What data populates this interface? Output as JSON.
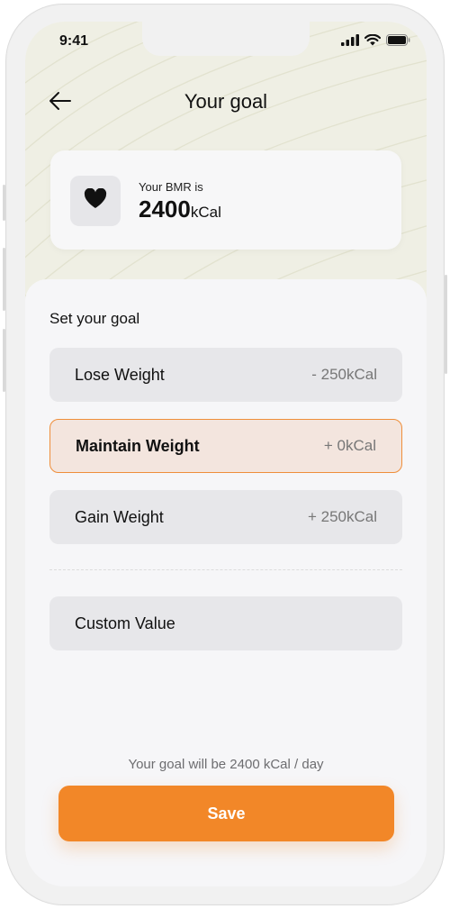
{
  "status_bar": {
    "time": "9:41"
  },
  "header": {
    "title": "Your goal",
    "back_icon": "arrow-left-icon"
  },
  "bmr": {
    "label": "Your BMR is",
    "value": "2400",
    "unit": "kCal",
    "icon": "heart-icon"
  },
  "goal_section": {
    "title": "Set your goal",
    "options": [
      {
        "label": "Lose Weight",
        "delta": "- 250kCal",
        "selected": false
      },
      {
        "label": "Maintain Weight",
        "delta": "+ 0kCal",
        "selected": true
      },
      {
        "label": "Gain Weight",
        "delta": "+ 250kCal",
        "selected": false
      }
    ],
    "custom_label": "Custom Value"
  },
  "footer": {
    "summary": "Your goal will be 2400 kCal / day",
    "save_label": "Save"
  },
  "colors": {
    "accent": "#f28728",
    "selected_bg": "#f3e5de",
    "option_bg": "#e7e7ea"
  }
}
